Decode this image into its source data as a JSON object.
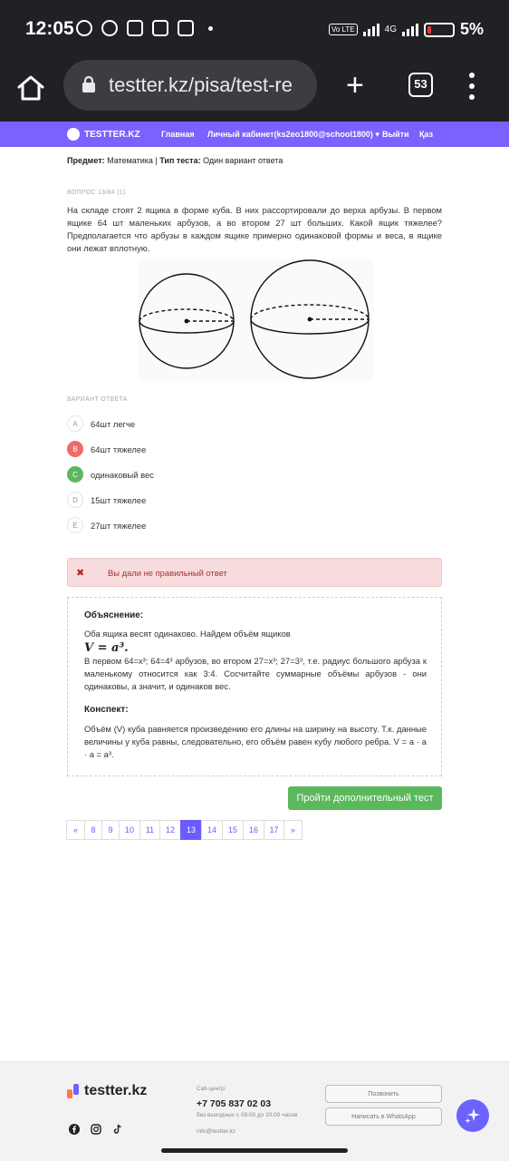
{
  "status_bar": {
    "time": "12:05",
    "network": "4G",
    "volte": "Vo LTE",
    "battery_pct": "5%"
  },
  "browser": {
    "url": "testter.kz/pisa/test-re",
    "tab_count": "53"
  },
  "site_nav": {
    "logo": "TESTTER.KZ",
    "items": [
      "Главная",
      "Личный кабинет(ks2eo1800@school1800) ▾",
      "Выйти",
      "Қаз"
    ]
  },
  "meta": {
    "subject_label": "Предмет:",
    "subject_value": "Математика",
    "separator": "|",
    "type_label": "Тип теста:",
    "type_value": "Один вариант ответа"
  },
  "question": {
    "number": "ВОПРОС 13/84 (1)",
    "text": "На складе стоят 2 ящика в форме куба. В них рассортировали до верха арбузы. В первом ящике 64 шт маленьких арбузов, а во втором 27 шт больших. Какой ящик тяжелее? Предполагается что арбузы в каждом ящике примерно одинаковой формы и веса, в ящике они лежат вплотную."
  },
  "answers_label": "ВАРИАНТ ОТВЕТА",
  "answers": [
    {
      "letter": "A",
      "text": "64шт легче",
      "state": "none"
    },
    {
      "letter": "B",
      "text": "64шт тяжелее",
      "state": "wrong"
    },
    {
      "letter": "C",
      "text": "одинаковый вес",
      "state": "right"
    },
    {
      "letter": "D",
      "text": "15шт тяжелее",
      "state": "none"
    },
    {
      "letter": "E",
      "text": "27шт тяжелее",
      "state": "none"
    }
  ],
  "result": {
    "text": "Вы дали не правильный ответ"
  },
  "explanation": {
    "title": "Объяснение:",
    "line1": "Оба ящика весят одинаково. Найдем объём ящиков",
    "formula": "V = a³.",
    "line2": "В первом 64=x³; 64=4³ арбузов, во втором 27=x³; 27=3³, т.е. радиус большого арбуза к маленькому относится как 3:4. Сосчитайте суммарные объёмы арбузов - они одинаковы, а значит, и одинаков вес.",
    "summary_title": "Конспект:",
    "summary": "Объём (V) куба равняется произведению его длины на ширину на высоту. Т.к. данные величины у куба равны, следовательно, его объём равен кубу любого ребра. V = a · a · a = a³."
  },
  "more_test_button": "Пройти дополнительный тест",
  "pagination": [
    "«",
    "8",
    "9",
    "10",
    "11",
    "12",
    "13",
    "14",
    "15",
    "16",
    "17",
    "»"
  ],
  "pagination_active": "13",
  "footer": {
    "logo": "testter.kz",
    "call_label": "Call-центр:",
    "phone": "+7 705 837 02 03",
    "hours": "без выходных с 08:00 до 20:00 часов",
    "email": "info@testter.kz",
    "call_button": "Позвонить",
    "whatsapp_button": "Написать в WhatsApp"
  }
}
